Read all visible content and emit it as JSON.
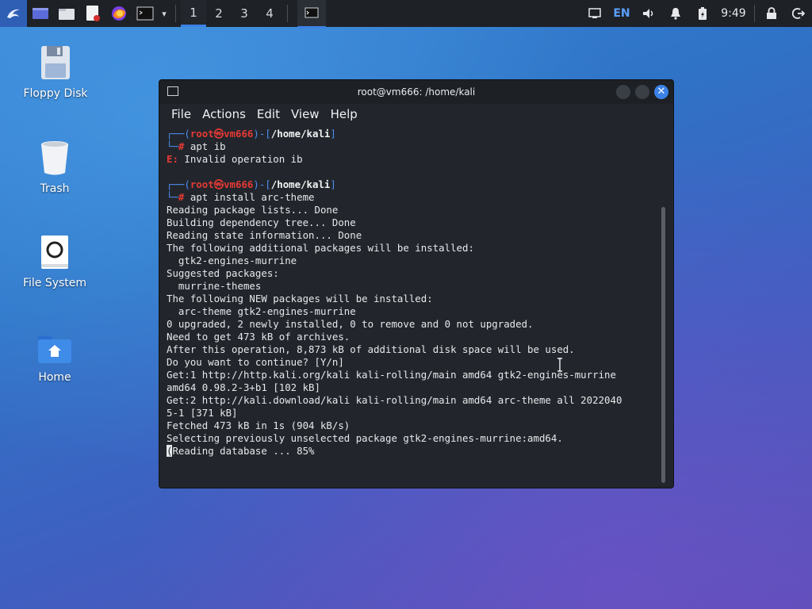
{
  "panel": {
    "workspaces": [
      "1",
      "2",
      "3",
      "4"
    ],
    "active_workspace": "1",
    "lang": "EN",
    "clock": "9:49",
    "icons": [
      "kali-menu-icon",
      "desktop-icon",
      "files-icon",
      "text-editor-icon",
      "firefox-icon",
      "terminal-icon",
      "chevron-down-icon",
      "terminal-task-icon",
      "display-icon",
      "volume-icon",
      "bell-icon",
      "battery-icon",
      "lock-icon",
      "logout-icon"
    ]
  },
  "desktop": {
    "icons": [
      {
        "label": "Floppy Disk",
        "icon": "floppy-icon"
      },
      {
        "label": "Trash",
        "icon": "trash-icon"
      },
      {
        "label": "File System",
        "icon": "drive-icon"
      },
      {
        "label": "Home",
        "icon": "home-folder-icon"
      }
    ]
  },
  "terminal": {
    "title": "root@vm666: /home/kali",
    "menu": [
      "File",
      "Actions",
      "Edit",
      "View",
      "Help"
    ],
    "prompt": {
      "user": "root",
      "host": "vm666",
      "path": "/home/kali",
      "symbol": "#"
    },
    "commands": [
      "apt ib",
      "apt install arc-theme"
    ],
    "error_tag": "E:",
    "error_text": " Invalid operation ib",
    "output": [
      "Reading package lists... Done",
      "Building dependency tree... Done",
      "Reading state information... Done",
      "The following additional packages will be installed:",
      "  gtk2-engines-murrine",
      "Suggested packages:",
      "  murrine-themes",
      "The following NEW packages will be installed:",
      "  arc-theme gtk2-engines-murrine",
      "0 upgraded, 2 newly installed, 0 to remove and 0 not upgraded.",
      "Need to get 473 kB of archives.",
      "After this operation, 8,873 kB of additional disk space will be used.",
      "Do you want to continue? [Y/n]",
      "Get:1 http://http.kali.org/kali kali-rolling/main amd64 gtk2-engines-murrine",
      "amd64 0.98.2-3+b1 [102 kB]",
      "Get:2 http://kali.download/kali kali-rolling/main amd64 arc-theme all 2022040",
      "5-1 [371 kB]",
      "Fetched 473 kB in 1s (904 kB/s)",
      "Selecting previously unselected package gtk2-engines-murrine:amd64."
    ],
    "last_line_cursor": "(",
    "last_line": "Reading database ... 85%"
  }
}
